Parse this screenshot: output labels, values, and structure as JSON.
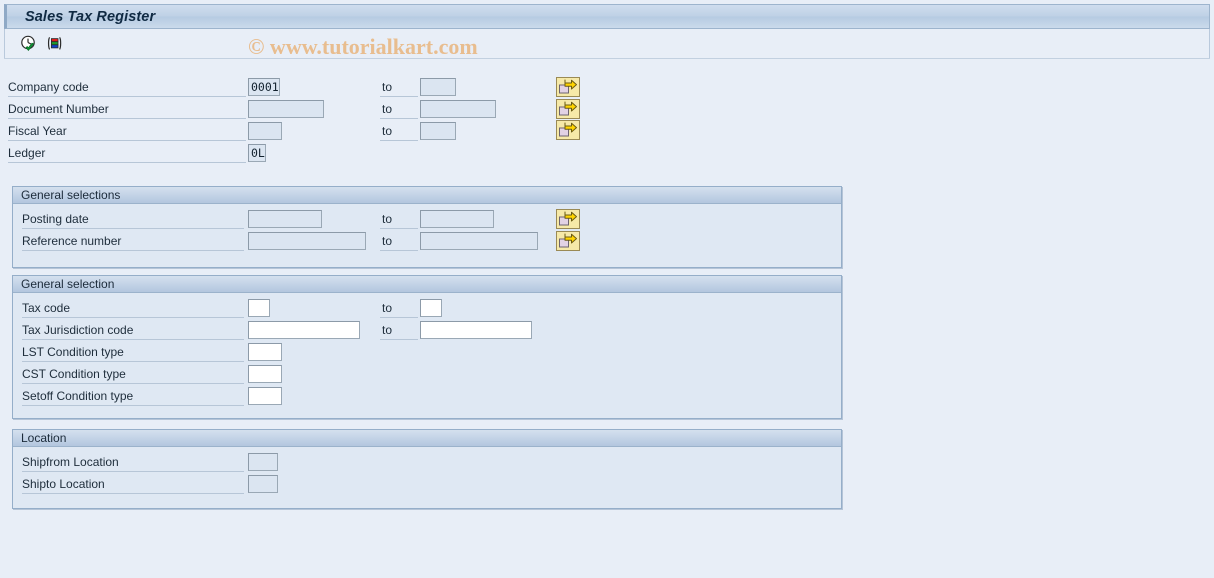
{
  "window": {
    "title": "Sales Tax Register"
  },
  "toolbar": {
    "execute_label": "Execute",
    "variant_label": "Get Variant",
    "icons": [
      "clock-check-icon",
      "variant-bars-icon"
    ]
  },
  "watermark": {
    "text": "© www.tutorialkart.com",
    "color": "#e8bd8f"
  },
  "selection_screen": {
    "to_label": "to",
    "header_fields": [
      {
        "label": "Company code",
        "value": "0001",
        "to_value": "",
        "has_range": true,
        "has_multi": true,
        "multi_icon": "multiple-selection-arrow-icon"
      },
      {
        "label": "Document Number",
        "value": "",
        "to_value": "",
        "has_range": true,
        "has_multi": true,
        "multi_icon": "multiple-selection-arrow-icon"
      },
      {
        "label": "Fiscal Year",
        "value": "",
        "to_value": "",
        "has_range": true,
        "has_multi": true,
        "multi_icon": "multiple-selection-arrow-icon"
      },
      {
        "label": "Ledger",
        "value": "0L",
        "to_value": "",
        "has_range": false,
        "has_multi": false,
        "multi_icon": ""
      }
    ],
    "groups": [
      {
        "title": "General selections",
        "fields": [
          {
            "label": "Posting date",
            "value": "",
            "to_value": "",
            "has_range": true,
            "has_multi": true
          },
          {
            "label": "Reference number",
            "value": "",
            "to_value": "",
            "has_range": true,
            "has_multi": true
          }
        ]
      },
      {
        "title": "General selection",
        "fields": [
          {
            "label": "Tax code",
            "value": "",
            "to_value": "",
            "has_range": true,
            "has_multi": false
          },
          {
            "label": "Tax Jurisdiction code",
            "value": "",
            "to_value": "",
            "has_range": true,
            "has_multi": false
          },
          {
            "label": "LST Condition type",
            "value": "",
            "to_value": "",
            "has_range": false,
            "has_multi": false
          },
          {
            "label": "CST Condition type",
            "value": "",
            "to_value": "",
            "has_range": false,
            "has_multi": false
          },
          {
            "label": "Setoff Condition type",
            "value": "",
            "to_value": "",
            "has_range": false,
            "has_multi": false
          }
        ]
      },
      {
        "title": "Location",
        "fields": [
          {
            "label": "Shipfrom Location",
            "value": "",
            "to_value": "",
            "has_range": false,
            "has_multi": false
          },
          {
            "label": "Shipto Location",
            "value": "",
            "to_value": "",
            "has_range": false,
            "has_multi": false
          }
        ]
      }
    ]
  }
}
